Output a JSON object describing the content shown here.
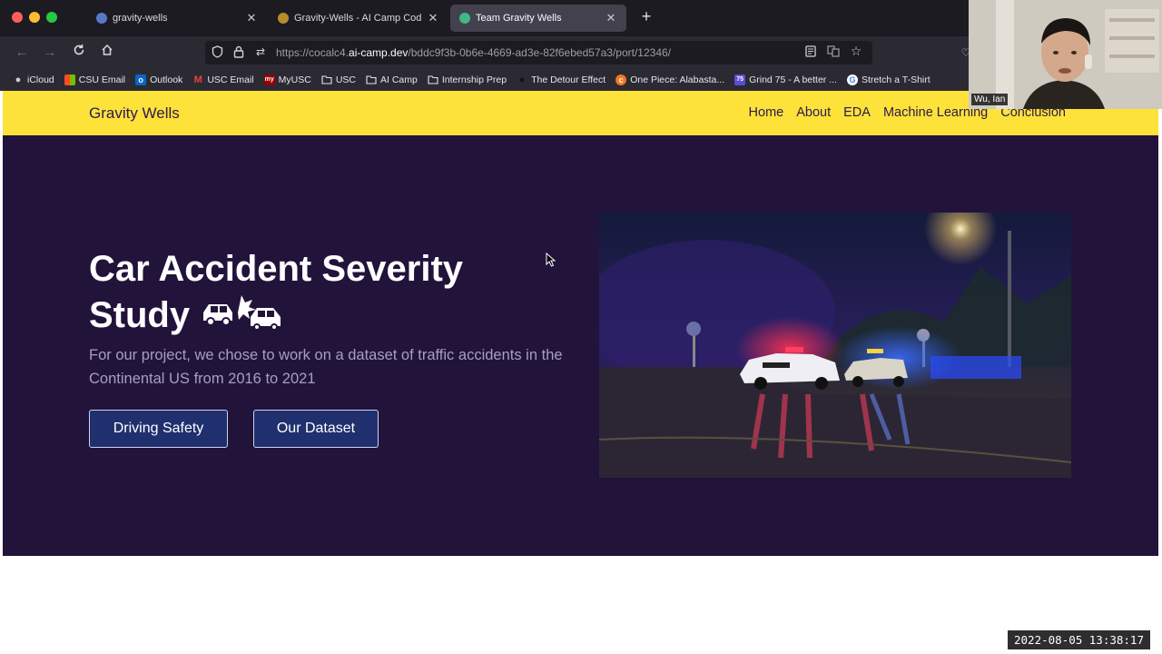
{
  "tabs": [
    {
      "label": "gravity-wells",
      "icon": "github-icon",
      "active": false
    },
    {
      "label": "Gravity-Wells - AI Camp Coding",
      "icon": "aicamp-icon",
      "active": false
    },
    {
      "label": "Team Gravity Wells",
      "icon": "site-icon",
      "active": true
    }
  ],
  "toolbar": {
    "url_prefix": "https://cocalc4.",
    "url_domain": "ai-camp.dev",
    "url_path": "/bddc9f3b-0b6e-4669-ad3e-82f6ebed57a3/port/12346/"
  },
  "bookmarks": [
    {
      "label": "iCloud",
      "icon": "apple-icon",
      "color": "#cfcfcf"
    },
    {
      "label": "CSU Email",
      "icon": "microsoft-icon",
      "color": "#f25022"
    },
    {
      "label": "Outlook",
      "icon": "outlook-icon",
      "color": "#0a64c8"
    },
    {
      "label": "USC Email",
      "icon": "gmail-icon",
      "color": "#ea4335"
    },
    {
      "label": "MyUSC",
      "icon": "myusc-icon",
      "color": "#990000"
    },
    {
      "label": "USC",
      "icon": "folder-icon",
      "color": ""
    },
    {
      "label": "AI Camp",
      "icon": "folder-icon",
      "color": ""
    },
    {
      "label": "Internship Prep",
      "icon": "folder-icon",
      "color": ""
    },
    {
      "label": "The Detour Effect",
      "icon": "detour-icon",
      "color": "#111111"
    },
    {
      "label": "One Piece: Alabasta...",
      "icon": "crunchyroll-icon",
      "color": "#f47521"
    },
    {
      "label": "Grind 75 - A better ...",
      "icon": "grind75-icon",
      "color": "#5b4fcf"
    },
    {
      "label": "Stretch a T-Shirt",
      "icon": "google-icon",
      "color": "#4285f4"
    }
  ],
  "site": {
    "brand": "Gravity Wells",
    "nav": [
      "Home",
      "About",
      "EDA",
      "Machine Learning",
      "Conclusion"
    ],
    "hero_title": "Car Accident Severity Study",
    "hero_desc": "For our project, we chose to work on a dataset of traffic accidents in the Continental US from 2016 to 2021",
    "buttons": [
      "Driving Safety",
      "Our Dataset"
    ]
  },
  "webcam": {
    "name": "Wu, Ian"
  },
  "timestamp": "2022-08-05 13:38:17",
  "colors": {
    "header_yellow": "#fde23a",
    "hero_bg": "#22133b",
    "button_bg": "#20306e",
    "brand_text": "#2d1a4d"
  }
}
